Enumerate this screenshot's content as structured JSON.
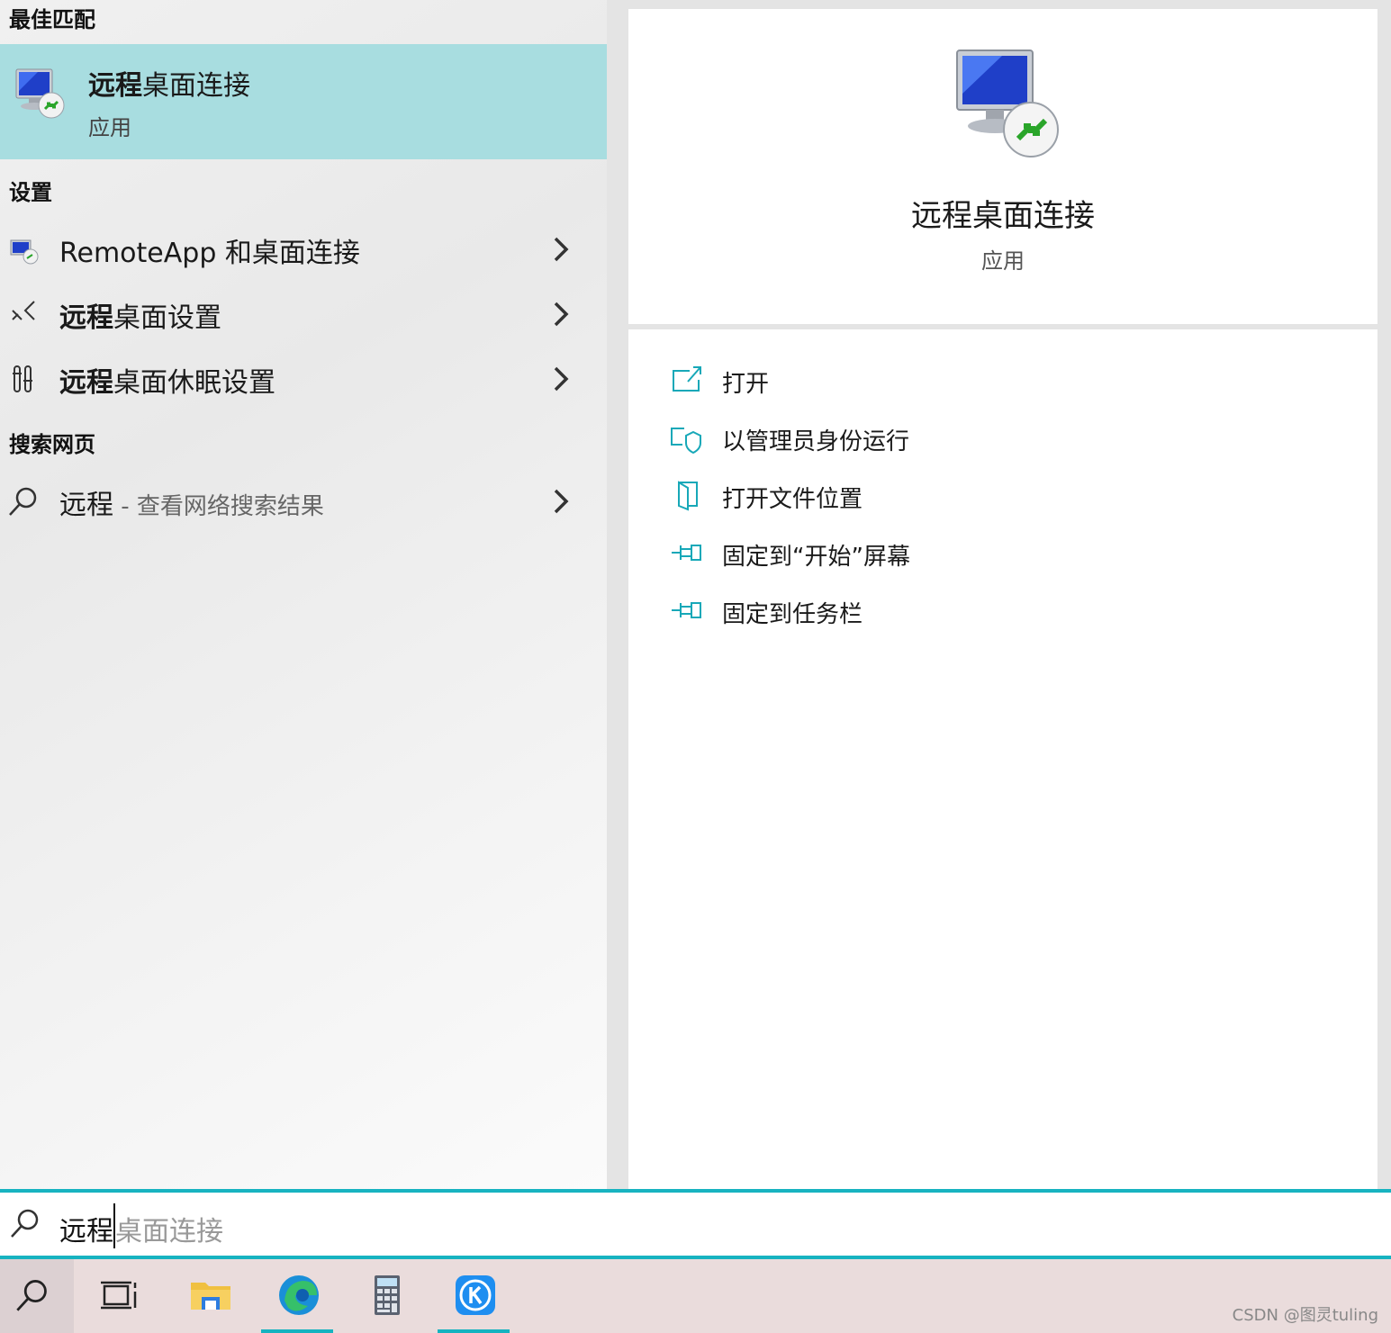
{
  "colors": {
    "accent": "#17b3c0",
    "best_match_bg": "#a8dde0",
    "action_icon": "#17a8b8",
    "taskbar_bg": "#eadcdc"
  },
  "left": {
    "best_match_header": "最佳匹配",
    "best_match": {
      "icon": "remote-desktop-icon",
      "title_bold": "远程",
      "title_rest": "桌面连接",
      "subtitle": "应用"
    },
    "settings_header": "设置",
    "settings": [
      {
        "icon": "remoteapp-icon",
        "bold": "",
        "rest": "RemoteApp 和桌面连接"
      },
      {
        "icon": "remote-settings-icon",
        "bold": "远程",
        "rest": "桌面设置"
      },
      {
        "icon": "sleep-settings-icon",
        "bold": "远程",
        "rest": "桌面休眠设置"
      }
    ],
    "web_header": "搜索网页",
    "web": {
      "icon": "search-icon",
      "query": "远程",
      "suffix": " - 查看网络搜索结果"
    }
  },
  "right": {
    "title": "远程桌面连接",
    "subtitle": "应用",
    "actions": [
      {
        "icon": "open-icon",
        "label": "打开"
      },
      {
        "icon": "admin-shield-icon",
        "label": "以管理员身份运行"
      },
      {
        "icon": "file-location-icon",
        "label": "打开文件位置"
      },
      {
        "icon": "pin-start-icon",
        "label": "固定到“开始”屏幕"
      },
      {
        "icon": "pin-taskbar-icon",
        "label": "固定到任务栏"
      }
    ]
  },
  "search": {
    "typed": "远程",
    "suggestion": "桌面连接"
  },
  "taskbar": {
    "items": [
      {
        "icon": "task-view-icon",
        "active": false
      },
      {
        "icon": "file-explorer-icon",
        "active": false
      },
      {
        "icon": "edge-icon",
        "active": true
      },
      {
        "icon": "calculator-icon",
        "active": false
      },
      {
        "icon": "k-app-icon",
        "active": true
      }
    ]
  },
  "watermark": "CSDN @图灵tuling"
}
